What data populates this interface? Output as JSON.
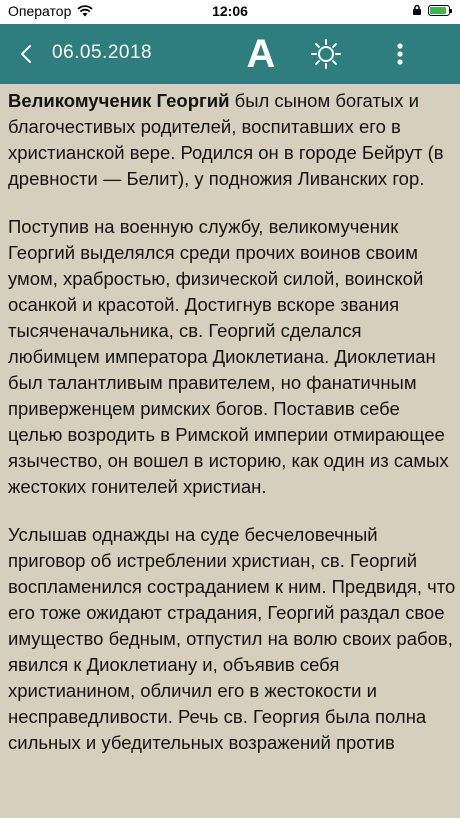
{
  "status_bar": {
    "carrier": "Оператор",
    "time": "12:06",
    "battery_level": 0.9,
    "battery_color": "#2fbf44"
  },
  "nav_bar": {
    "date": "06.05.2018",
    "font_label": "A",
    "icons": {
      "back": "chevron-left-icon",
      "brightness": "sun-icon",
      "more": "vertical-dots-icon"
    },
    "background": "#2e7e80"
  },
  "article": {
    "title": "Великомученик Георгий",
    "p1_rest": " был сыном богатых и благочестивых родителей, воспитавших его в христианской вере. Родился он в городе Бейрут (в древности — Белит), у подножия Ливанских гор.",
    "p2": "Поступив на военную службу, великомученик Георгий выделялся среди прочих воинов своим умом, храбростью, физической силой, воинской осанкой и красотой. Достигнув вскоре звания тысяченачальника, св. Георгий сделался любимцем императора Диоклетиана. Диоклетиан был талантливым правителем, но фанатичным приверженцем римских богов. Поставив себе целью возродить в Римской империи отмирающее язычество, он вошел в историю, как один из самых жестоких гонителей христиан.",
    "p3": "Услышав однажды на суде бесчеловечный приговор об истреблении христиан, св. Георгий воспламенился состраданием к ним. Предвидя, что его тоже ожидают страдания, Георгий раздал свое имущество бедным, отпустил на волю своих рабов, явился к Диоклетиану и, объявив себя христианином, обличил его в жестокости и несправедливости. Речь св. Георгия была полна сильных и убедительных возражений против"
  }
}
